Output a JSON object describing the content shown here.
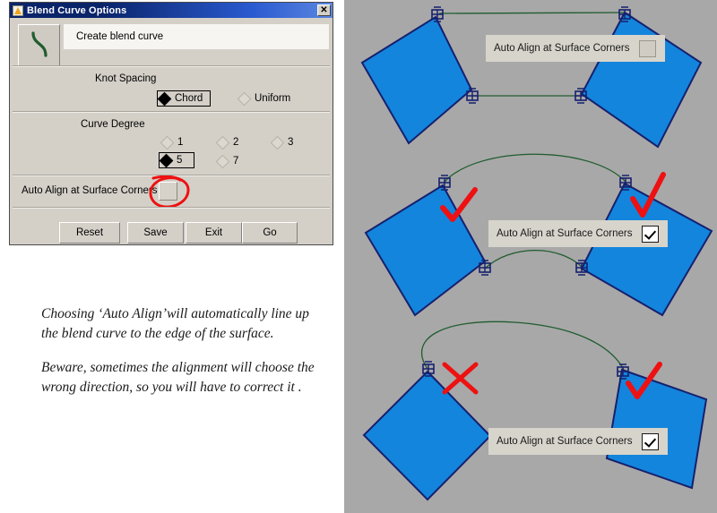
{
  "dialog": {
    "title": "Blend Curve Options",
    "app_icon": "triangle-app-icon",
    "close_label": "✕",
    "header_caption": "Create blend curve",
    "header_icon": "s-curve-icon",
    "knot_spacing": {
      "label": "Knot Spacing",
      "options": [
        {
          "label": "Chord",
          "selected": true
        },
        {
          "label": "Uniform",
          "selected": false
        }
      ]
    },
    "curve_degree": {
      "label": "Curve Degree",
      "options": [
        {
          "label": "1",
          "selected": false
        },
        {
          "label": "2",
          "selected": false
        },
        {
          "label": "3",
          "selected": false
        },
        {
          "label": "5",
          "selected": true
        },
        {
          "label": "7",
          "selected": false
        }
      ]
    },
    "auto_align": {
      "label": "Auto Align at Surface Corners",
      "checked": false,
      "annotation": "red-circle-highlight"
    },
    "buttons": [
      {
        "label": "Reset"
      },
      {
        "label": "Save"
      },
      {
        "label": "Exit"
      },
      {
        "label": "Go"
      }
    ]
  },
  "caption": {
    "paragraph_1": "Choosing ‘Auto Align’will automatically line up the blend curve to the edge of the surface.",
    "paragraph_2": "Beware, sometimes the alignment will choose the wrong direction, so you will have to correct it ."
  },
  "viewport": {
    "background_color": "#a8a8a8",
    "surface_fill": "#1385dc",
    "surface_stroke": "#0d1a6e",
    "curve_color": "#1f5c2e",
    "annotation_color": "#ee1111",
    "panels": [
      {
        "name": "auto-align-off",
        "box_label": "Auto Align at Surface Corners",
        "checked": false,
        "blend_style": "straight-lines",
        "marks": []
      },
      {
        "name": "auto-align-on-correct",
        "box_label": "Auto Align at Surface Corners",
        "checked": true,
        "blend_style": "aligned-arcs",
        "marks": [
          "check",
          "check"
        ]
      },
      {
        "name": "auto-align-on-wrong-direction",
        "box_label": "Auto Align at Surface Corners",
        "checked": true,
        "blend_style": "single-wrong-arc",
        "marks": [
          "cross",
          "check"
        ]
      }
    ]
  }
}
